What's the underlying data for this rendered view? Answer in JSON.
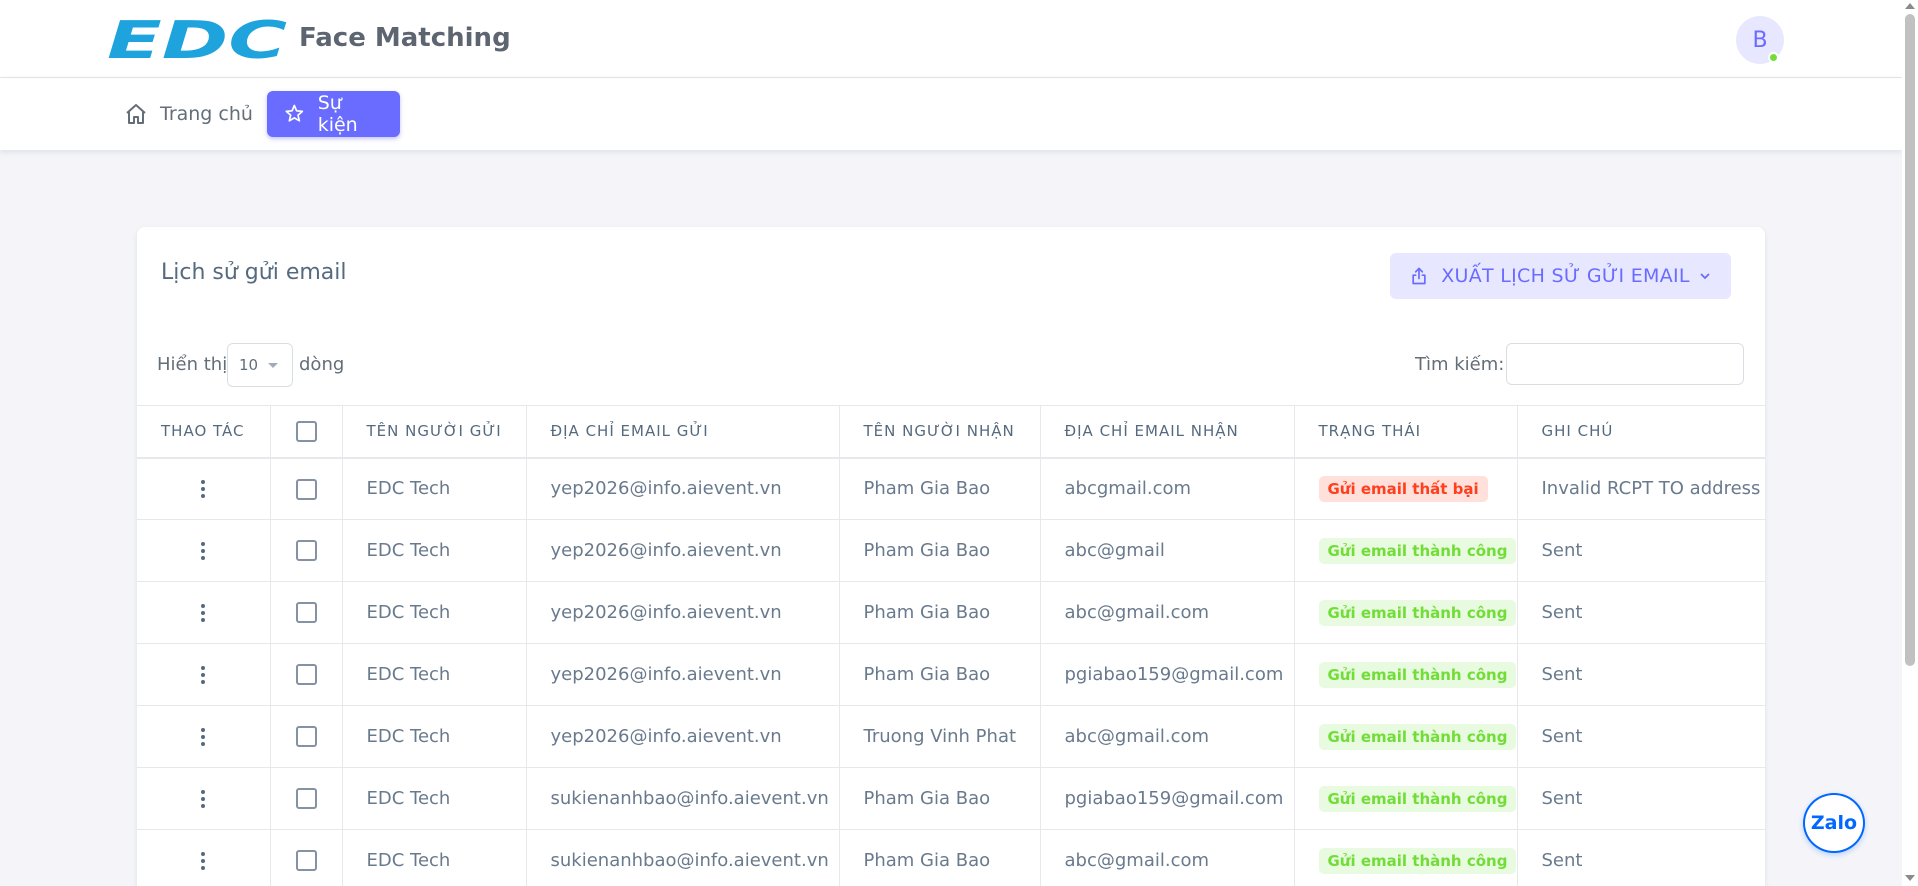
{
  "header": {
    "logo_text": "EDC",
    "app_title": "Face Matching",
    "avatar_initial": "B"
  },
  "nav": {
    "home": "Trang chủ",
    "events": "Sự kiện"
  },
  "card": {
    "title": "Lịch sử gửi email",
    "export_label": "XUẤT LỊCH SỬ GỬI EMAIL",
    "length_label": "Hiển thị",
    "length_value": "10",
    "length_suffix": "dòng",
    "search_label": "Tìm kiếm:",
    "search_value": ""
  },
  "table": {
    "columns": [
      "THAO TÁC",
      "",
      "TÊN NGƯỜI GỬI",
      "ĐỊA CHỈ EMAIL GỬI",
      "TÊN NGƯỜI NHẬN",
      "ĐỊA CHỈ EMAIL NHẬN",
      "TRẠNG THÁI",
      "GHI CHÚ"
    ],
    "rows": [
      {
        "sender": "EDC Tech",
        "sender_email": "yep2026@info.aievent.vn",
        "recipient": "Pham Gia Bao",
        "recipient_email": "abcgmail.com",
        "status": "Gửi email thất bại",
        "status_type": "fail",
        "note": "Invalid RCPT TO address p"
      },
      {
        "sender": "EDC Tech",
        "sender_email": "yep2026@info.aievent.vn",
        "recipient": "Pham Gia Bao",
        "recipient_email": "abc@gmail",
        "status": "Gửi email thành công",
        "status_type": "ok",
        "note": "Sent"
      },
      {
        "sender": "EDC Tech",
        "sender_email": "yep2026@info.aievent.vn",
        "recipient": "Pham Gia Bao",
        "recipient_email": "abc@gmail.com",
        "status": "Gửi email thành công",
        "status_type": "ok",
        "note": "Sent"
      },
      {
        "sender": "EDC Tech",
        "sender_email": "yep2026@info.aievent.vn",
        "recipient": "Pham Gia Bao",
        "recipient_email": "pgiabao159@gmail.com",
        "status": "Gửi email thành công",
        "status_type": "ok",
        "note": "Sent"
      },
      {
        "sender": "EDC Tech",
        "sender_email": "yep2026@info.aievent.vn",
        "recipient": "Truong Vinh Phat",
        "recipient_email": "abc@gmail.com",
        "status": "Gửi email thành công",
        "status_type": "ok",
        "note": "Sent"
      },
      {
        "sender": "EDC Tech",
        "sender_email": "sukienanhbao@info.aievent.vn",
        "recipient": "Pham Gia Bao",
        "recipient_email": "pgiabao159@gmail.com",
        "status": "Gửi email thành công",
        "status_type": "ok",
        "note": "Sent"
      },
      {
        "sender": "EDC Tech",
        "sender_email": "sukienanhbao@info.aievent.vn",
        "recipient": "Pham Gia Bao",
        "recipient_email": "abc@gmail.com",
        "status": "Gửi email thành công",
        "status_type": "ok",
        "note": "Sent"
      }
    ]
  },
  "widget": {
    "zalo_label": "Zalo"
  },
  "colors": {
    "primary": "#696cff",
    "logo_blue": "#1ea3dc",
    "success": "#71dd37",
    "danger": "#ff3e1d"
  }
}
